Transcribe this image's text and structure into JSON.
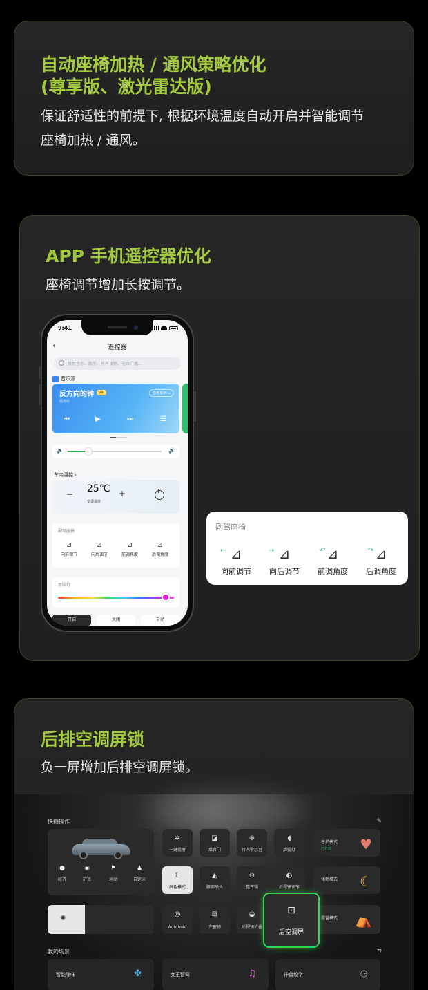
{
  "card1": {
    "title_line1": "自动座椅加热 / 通风策略优化",
    "title_line2": "(尊享版、激光雷达版)",
    "desc_line1": "保证舒适性的前提下, 根据环境温度自动开启并智能调节",
    "desc_line2": "座椅加热 / 通风。"
  },
  "card2": {
    "title": "APP 手机遥控器优化",
    "desc": "座椅调节增加长按调节。",
    "phone": {
      "time": "9:41",
      "back": "‹",
      "header": "遥控器",
      "search_placeholder": "搜索音乐、歌手、有声读物、电台广播...",
      "music_source_label": "音乐源",
      "song": "反方向的钟",
      "vip": "VIP",
      "artist": "周杰伦",
      "source_chip": "音乐显示 ⌄",
      "prev": "⏮",
      "play": "▶",
      "next": "⏭",
      "list": "☰",
      "vol_low": "🔈",
      "vol_high": "🔊",
      "volume_level": 0.22,
      "climate_label": "车内温控 ›",
      "minus": "−",
      "temp": "25℃",
      "climate_sub": "空调温度",
      "plus": "+",
      "seat_title": "副驾座椅",
      "seat_items": [
        "向前调节",
        "向后调节",
        "前调角度",
        "后调角度"
      ],
      "ambient_title": "氛围灯",
      "ambient_color": "#e014d6",
      "tabs": [
        "开启",
        "关闭",
        "自动"
      ]
    },
    "seat_panel": {
      "title": "副驾座椅",
      "items": [
        "向前调节",
        "向后调节",
        "前调角度",
        "后调角度"
      ],
      "arrows": [
        "⇠",
        "⇢",
        "↶",
        "↷"
      ],
      "arrow_color": "#27b36a"
    }
  },
  "card3": {
    "title": "后排空调屏锁",
    "desc": "负一屏增加后排空调屏锁。",
    "dashboard": {
      "quick_ops_label": "快捷操作",
      "edit": "✎",
      "car_modes": [
        "经济",
        "舒适",
        "运动",
        "自定义"
      ],
      "row1": [
        "一键揽屏",
        "后背门",
        "行人警示音",
        "后雾灯"
      ],
      "row2": [
        "屏色模式",
        "腰部扇头",
        "整车锁",
        "后视镜调节"
      ],
      "row3": [
        "Autohold",
        "车窗锁",
        "后视镜折叠"
      ],
      "modes": [
        {
          "label": "守护模式",
          "sub": "已开启",
          "icon": "♥"
        },
        {
          "label": "休憩模式",
          "sub": "",
          "icon": "☾"
        },
        {
          "label": "露营模式",
          "sub": "",
          "icon": "⛺"
        }
      ],
      "highlight": "后空调屏",
      "highlight_color": "#33d457",
      "scenes_label": "我的场景",
      "scenes": [
        "智能除味",
        "女王智驾",
        "神兽纹学"
      ]
    }
  }
}
